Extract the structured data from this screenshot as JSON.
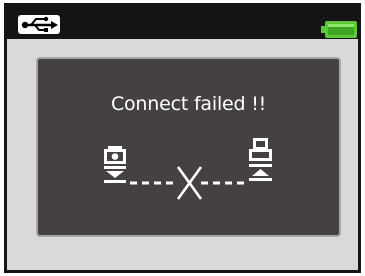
{
  "status_bar": {
    "connection_icon": "usb-icon",
    "battery_icon": "battery-full-icon"
  },
  "dialog": {
    "message": "Connect failed !!",
    "device_icon": "camera-icon",
    "target_icon": "printer-icon",
    "state_icon": "cross-icon"
  },
  "colors": {
    "background": "#d9d9d9",
    "status_bar": "#141414",
    "dialog_bg": "#454141",
    "dialog_border": "#a6a6a6",
    "text": "#ffffff",
    "battery": "#5fc63a"
  }
}
